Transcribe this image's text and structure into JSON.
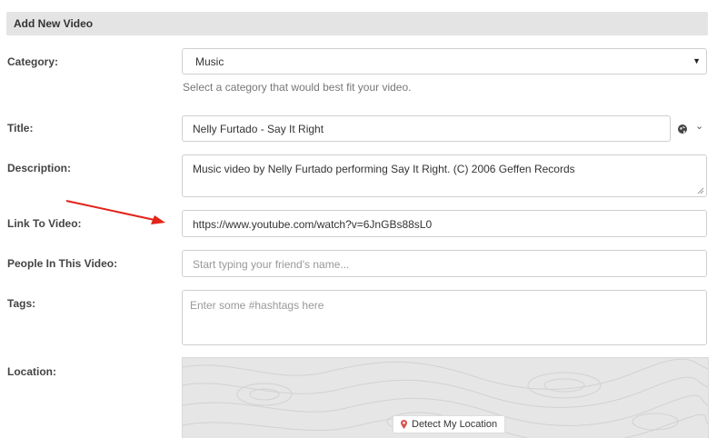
{
  "header": {
    "title": "Add New Video"
  },
  "form": {
    "category": {
      "label": "Category:",
      "value": "Music",
      "help": "Select a category that would best fit your video."
    },
    "title": {
      "label": "Title:",
      "value": "Nelly Furtado - Say It Right"
    },
    "description": {
      "label": "Description:",
      "value": "Music video by Nelly Furtado performing Say It Right. (C) 2006 Geffen Records"
    },
    "link": {
      "label": "Link To Video:",
      "value": "https://www.youtube.com/watch?v=6JnGBs88sL0"
    },
    "people": {
      "label": "People In This Video:",
      "placeholder": "Start typing your friend's name..."
    },
    "tags": {
      "label": "Tags:",
      "placeholder": "Enter some #hashtags here"
    },
    "location": {
      "label": "Location:",
      "detect_button": "Detect My Location"
    }
  },
  "colors": {
    "header_bg": "#e4e4e4",
    "arrow": "#e2231a",
    "map_bg": "#e6e6e6",
    "pin": "#d9534f"
  },
  "icons": {
    "privacy": "globe-icon",
    "privacy_menu": "chevron-down-icon",
    "location": "map-pin-icon"
  }
}
